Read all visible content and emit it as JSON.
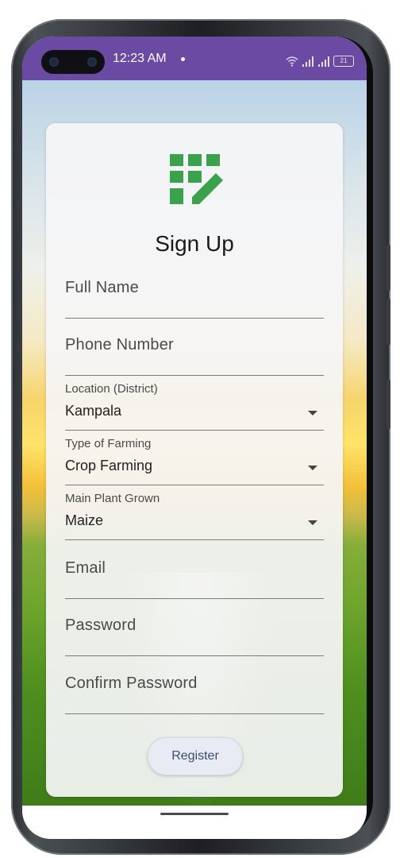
{
  "status_bar": {
    "time": "12:23 AM",
    "battery": "21",
    "color": "#6a4aa2"
  },
  "app": {
    "logo_icon": "grid-edit-icon",
    "logo_color": "#3aa24a",
    "title": "Sign Up"
  },
  "form": {
    "full_name": {
      "placeholder": "Full Name",
      "value": ""
    },
    "phone_number": {
      "placeholder": "Phone Number",
      "value": ""
    },
    "location": {
      "label": "Location (District)",
      "value": "Kampala"
    },
    "farming_type": {
      "label": "Type of Farming",
      "value": "Crop Farming"
    },
    "main_plant": {
      "label": "Main Plant Grown",
      "value": "Maize"
    },
    "email": {
      "placeholder": "Email",
      "value": ""
    },
    "password": {
      "placeholder": "Password",
      "value": ""
    },
    "confirm_password": {
      "placeholder": "Confirm Password",
      "value": ""
    },
    "register_label": "Register"
  }
}
